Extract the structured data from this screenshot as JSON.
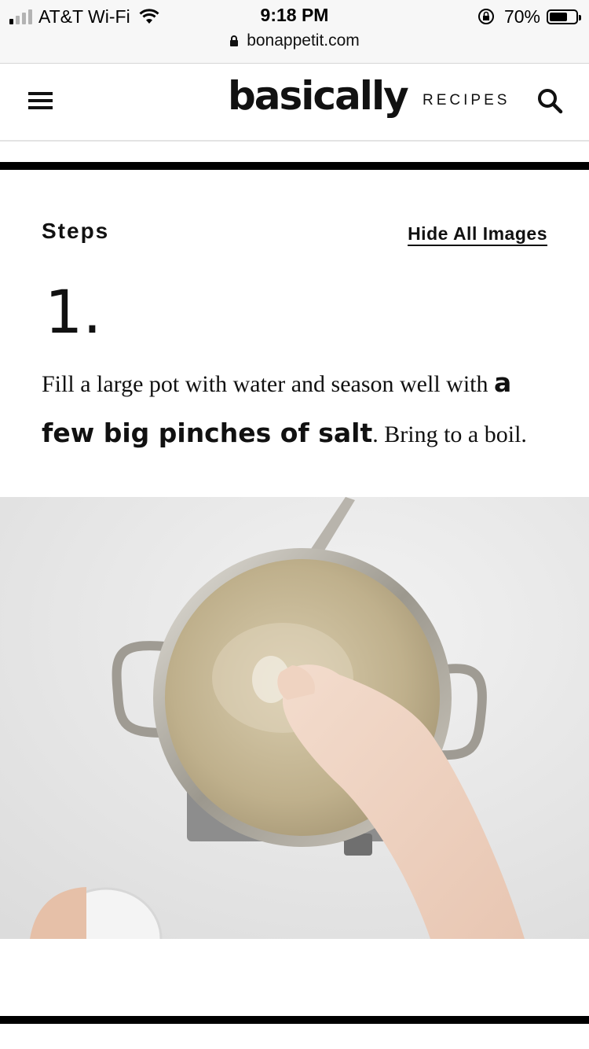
{
  "status_bar": {
    "carrier": "AT&T Wi-Fi",
    "time": "9:18 PM",
    "battery": "70%",
    "battery_level": 0.7,
    "url": "bonappetit.com"
  },
  "header": {
    "logo": "basically",
    "nav_recipes": "RECIPES"
  },
  "steps": {
    "title": "Steps",
    "hide_images": "Hide All Images",
    "items": [
      {
        "number": "1.",
        "text_before": "Fill a large pot with water and season well with",
        "ingredient": "a few big pinches of salt",
        "text_after": ". Bring to a boil."
      }
    ]
  },
  "icons": [
    "hamburger-menu-icon",
    "search-icon",
    "wifi-icon",
    "lock-icon",
    "rotation-lock-icon",
    "battery-icon"
  ]
}
